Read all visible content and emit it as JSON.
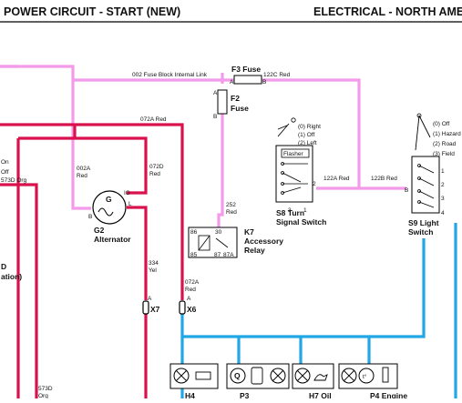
{
  "header": {
    "title": "POWER CIRCUIT - START (NEW)",
    "section": "ELECTRICAL - NORTH AMERICA"
  },
  "colors": {
    "pink": "#f39bea",
    "red": "#d9124e",
    "blue": "#21a6e6",
    "dark_red": "#b02030"
  },
  "wires": {
    "fuse_link": "002 Fuse Block Internal Link",
    "w122c": "122C Red",
    "w072a_top": "072A Red",
    "w002a": "002A\nRed",
    "w072d": "072D\nRed",
    "w573d_org": "573D Org",
    "w252": "252\nRed",
    "w122a": "122A Red",
    "w122b": "122B Red",
    "w334": "334\nYel",
    "w072a_x6": "072A\nRed",
    "w573d_bottom": "573D\nOrg"
  },
  "components": {
    "f3_fuse": "F3 Fuse",
    "f2": "F2",
    "f2_fuse": "Fuse",
    "g2_id": "G2",
    "g2_name": "Alternator",
    "k7_id": "K7",
    "k7_name1": "Accessory",
    "k7_name2": "Relay",
    "s8_id": "S8 Turn",
    "s8_name": "Signal Switch",
    "s9_id": "S9 Light",
    "s9_name": "Switch",
    "x7": "X7",
    "x6": "X6",
    "flasher": "Flasher",
    "h4": "H4",
    "p3": "P3",
    "h7": "H7 Oil",
    "p4": "P4 Engine"
  },
  "switch_positions": {
    "s8": [
      "(0) Right",
      "(1) Off",
      "(2) Left"
    ],
    "s9": [
      "(0) Off",
      "(1) Hazard",
      "(2) Road",
      "(3) Field"
    ]
  },
  "left_partial": [
    "On",
    "Off",
    "573D Org",
    "D",
    "ation)"
  ],
  "pins": {
    "f3_a": "A",
    "f3_b": "B",
    "f2_a": "A",
    "f2_b": "B",
    "g2_ig": "IG",
    "g2_b": "B",
    "g2_l": "L",
    "k7_86": "86",
    "k7_30": "30",
    "k7_85": "85",
    "k7_87": "87",
    "k7_87a": "87A",
    "s8_2": "2",
    "s8_3": "3",
    "s8_1": "1",
    "s9_b": "B",
    "s9_1": "1",
    "s9_2": "2",
    "s9_3": "3",
    "s9_4": "4",
    "x7_a": "A",
    "x6_a": "A"
  }
}
